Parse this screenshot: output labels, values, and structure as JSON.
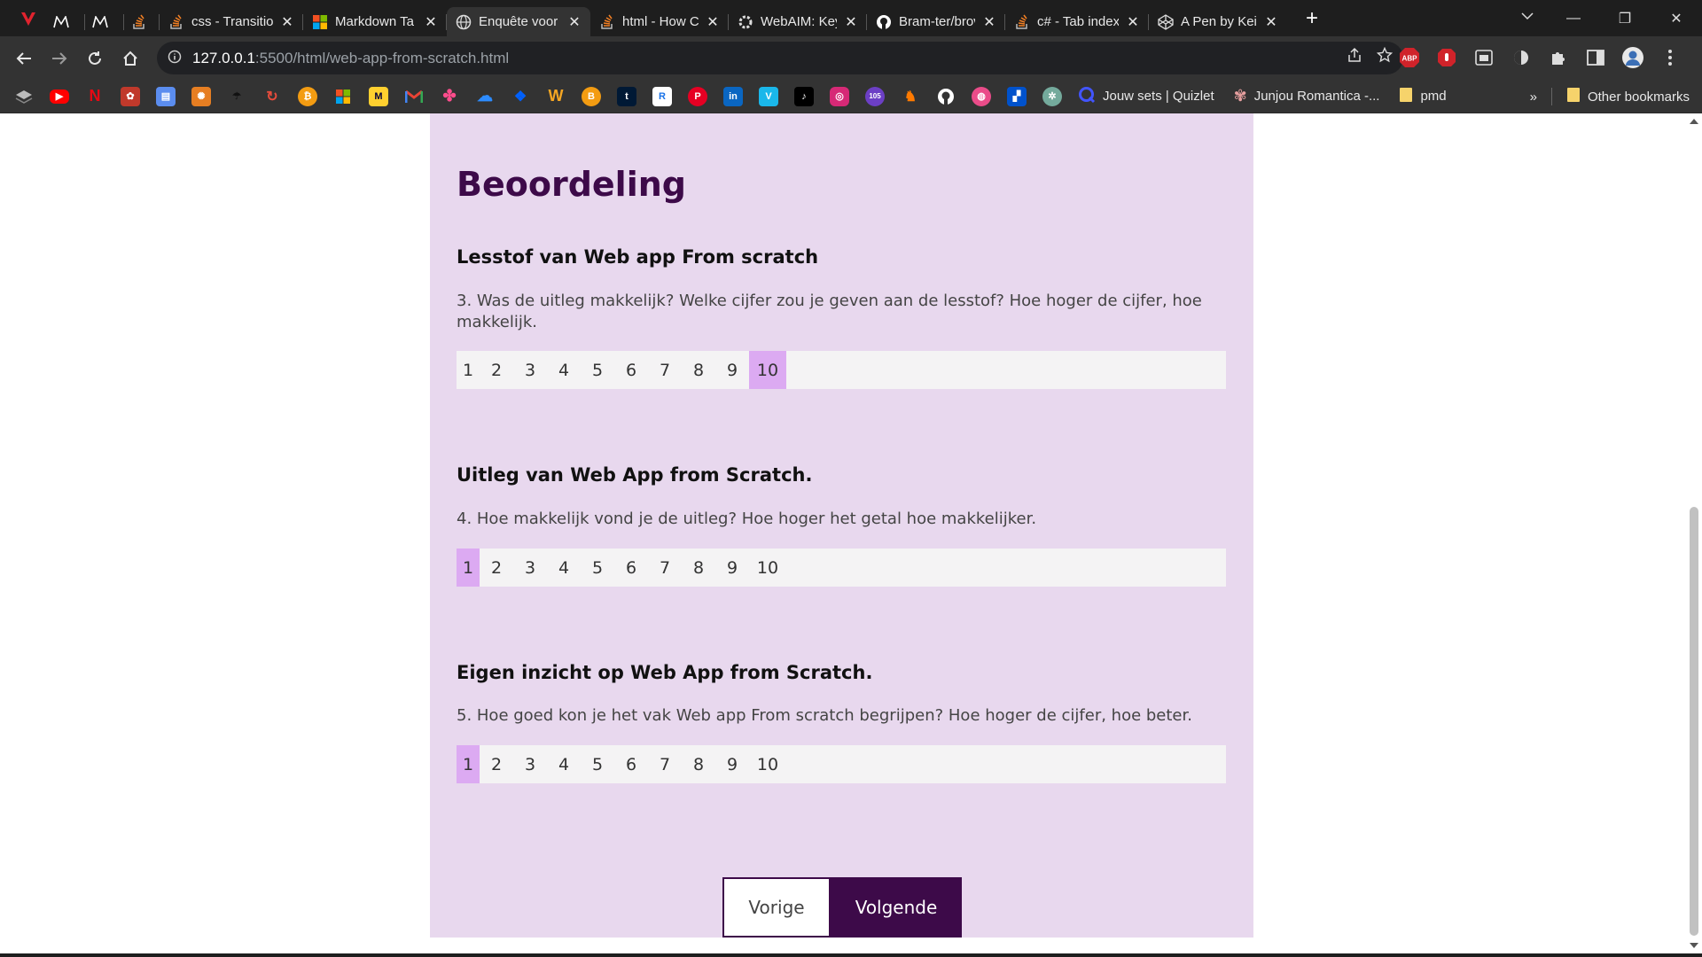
{
  "browser": {
    "tabs": [
      {
        "title": "",
        "icon": "m-icon"
      },
      {
        "title": "",
        "icon": "m-icon"
      },
      {
        "title": "",
        "icon": "stackoverflow-icon"
      },
      {
        "title": "css - Transition",
        "icon": "stackoverflow-icon"
      },
      {
        "title": "Markdown Ta",
        "icon": "windows-icon"
      },
      {
        "title": "Enquête voor",
        "icon": "globe-icon",
        "active": true
      },
      {
        "title": "html - How C",
        "icon": "stackoverflow-icon"
      },
      {
        "title": "WebAIM: Keyl",
        "icon": "webaim-icon"
      },
      {
        "title": "Bram-ter/brov",
        "icon": "github-icon"
      },
      {
        "title": "c# - Tab index",
        "icon": "stackoverflow-icon"
      },
      {
        "title": "A Pen by Keis",
        "icon": "codepen-icon"
      }
    ],
    "url_host": "127.0.0.1",
    "url_path": ":5500/html/web-app-from-scratch.html",
    "bookmarks": {
      "quizlet": "Jouw sets | Quizlet",
      "junjou": "Junjou Romantica -...",
      "pmd": "pmd",
      "more": "»",
      "other": "Other bookmarks"
    },
    "extension_abp": "ABP"
  },
  "page": {
    "heading": "Beoordeling",
    "questions": [
      {
        "title": "Lesstof van Web app From scratch",
        "text": "3. Was de uitleg makkelijk? Welke cijfer zou je geven aan de lesstof? Hoe hoger de cijfer, hoe makkelijk.",
        "options": [
          "1",
          "2",
          "3",
          "4",
          "5",
          "6",
          "7",
          "8",
          "9",
          "10"
        ],
        "selected": "10"
      },
      {
        "title": "Uitleg van Web App from Scratch.",
        "text": "4. Hoe makkelijk vond je de uitleg? Hoe hoger het getal hoe makkelijker.",
        "options": [
          "1",
          "2",
          "3",
          "4",
          "5",
          "6",
          "7",
          "8",
          "9",
          "10"
        ],
        "selected": "1"
      },
      {
        "title": "Eigen inzicht op Web App from Scratch.",
        "text": "5. Hoe goed kon je het vak Web app From scratch begrijpen? Hoe hoger de cijfer, hoe beter.",
        "options": [
          "1",
          "2",
          "3",
          "4",
          "5",
          "6",
          "7",
          "8",
          "9",
          "10"
        ],
        "selected": "1"
      }
    ],
    "prev_label": "Vorige",
    "next_label": "Volgende"
  },
  "colors": {
    "card_bg": "#e8d8ee",
    "accent": "#3d0a49",
    "selected_option": "#dcaaf2",
    "scale_bg": "#f4f3f4"
  }
}
